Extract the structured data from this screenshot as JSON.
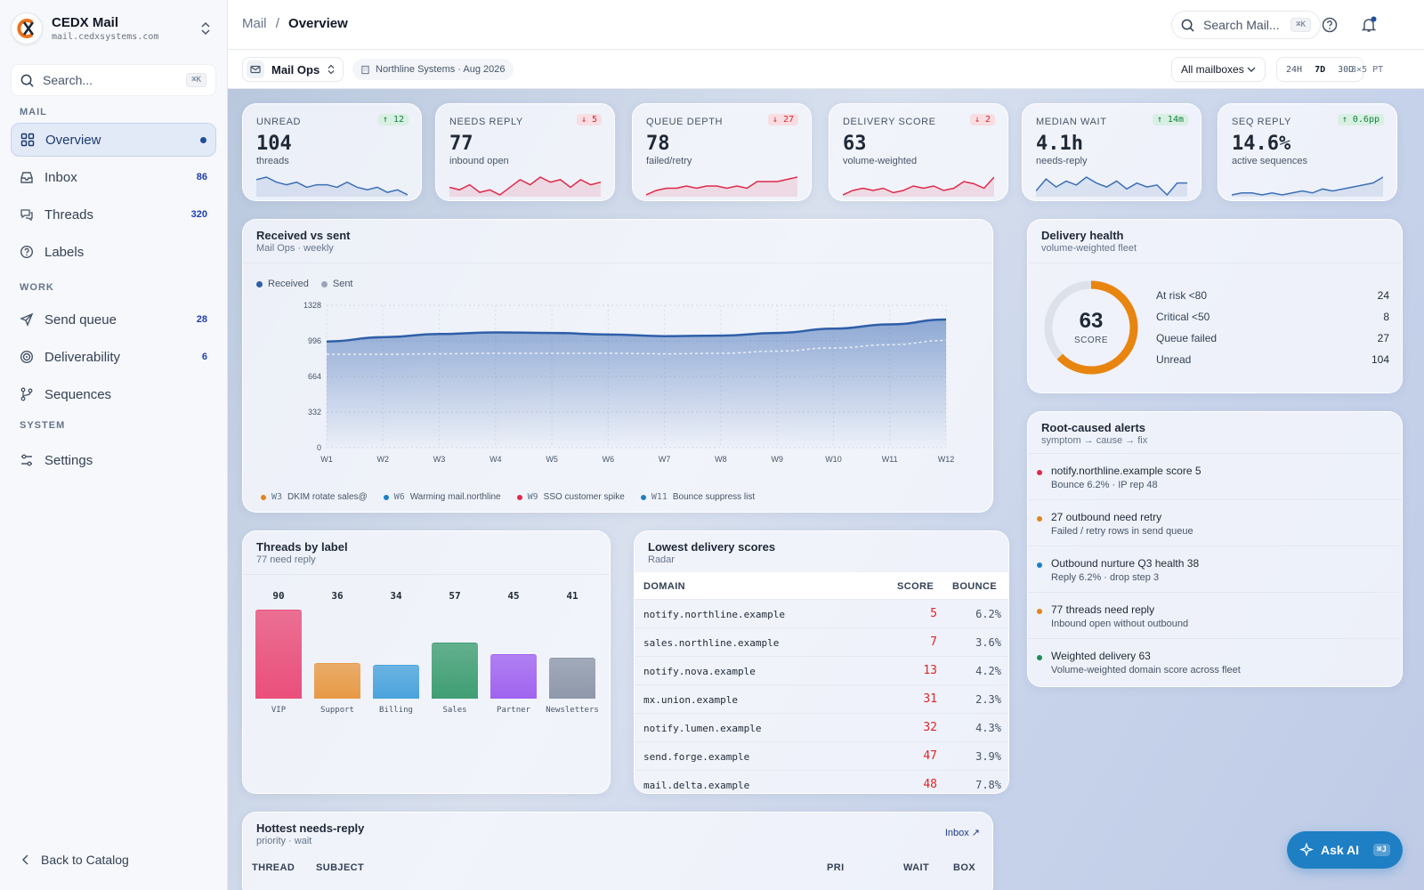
{
  "app": {
    "name": "CEDX Mail",
    "host": "mail.cedxsystems.com"
  },
  "sidebar": {
    "search_placeholder": "Search...",
    "search_kbd": "⌘K",
    "sections": {
      "mail": "MAIL",
      "work": "WORK",
      "system": "SYSTEM"
    },
    "items": [
      {
        "label": "Overview",
        "count": ""
      },
      {
        "label": "Inbox",
        "count": "86"
      },
      {
        "label": "Threads",
        "count": "320"
      },
      {
        "label": "Labels",
        "count": ""
      },
      {
        "label": "Send queue",
        "count": "28"
      },
      {
        "label": "Deliverability",
        "count": "6"
      },
      {
        "label": "Sequences",
        "count": ""
      },
      {
        "label": "Settings",
        "count": ""
      }
    ],
    "back": "Back to Catalog"
  },
  "header": {
    "crumb_root": "Mail",
    "crumb_sep": "/",
    "crumb_page": "Overview",
    "search_placeholder": "Search Mail...",
    "search_kbd": "⌘K"
  },
  "toolbar": {
    "workspace": "Mail Ops",
    "org": "Northline Systems · Aug 2026",
    "mailbox": "All mailboxes",
    "ranges": [
      "24H",
      "7D",
      "30D"
    ],
    "active_range": "7D",
    "tz": "8×5 PT"
  },
  "kpis": [
    {
      "label": "UNREAD",
      "value": "104",
      "sub": "threads",
      "delta": "↑ 12",
      "dir": "up",
      "spark": [
        14,
        15,
        13,
        12,
        13,
        11,
        12,
        12,
        11,
        13,
        11,
        10,
        11,
        9,
        10,
        8
      ],
      "color": "#3b6fb8"
    },
    {
      "label": "NEEDS REPLY",
      "value": "77",
      "sub": "inbound open",
      "delta": "↓ 5",
      "dir": "dn",
      "spark": [
        9,
        8,
        10,
        7,
        8,
        6,
        9,
        12,
        10,
        13,
        11,
        12,
        9,
        12,
        10,
        11
      ],
      "color": "#e0294a"
    },
    {
      "label": "QUEUE DEPTH",
      "value": "78",
      "sub": "failed/retry",
      "delta": "↓ 27",
      "dir": "dn",
      "spark": [
        5,
        7,
        8,
        8,
        9,
        8,
        9,
        9,
        8,
        9,
        8,
        11,
        11,
        11,
        12,
        13
      ],
      "color": "#e0294a"
    },
    {
      "label": "DELIVERY SCORE",
      "value": "63",
      "sub": "volume-weighted",
      "delta": "↓ 2",
      "dir": "dn",
      "spark": [
        6,
        8,
        9,
        8,
        9,
        7,
        8,
        10,
        9,
        10,
        8,
        9,
        12,
        11,
        9,
        14
      ],
      "color": "#e0294a"
    },
    {
      "label": "MEDIAN WAIT",
      "value": "4.1h",
      "sub": "needs-reply",
      "delta": "↑ 14m",
      "dir": "up",
      "spark": [
        8,
        14,
        10,
        13,
        11,
        15,
        12,
        10,
        13,
        9,
        12,
        10,
        11,
        6,
        12,
        12
      ],
      "color": "#3b6fb8"
    },
    {
      "label": "SEQ REPLY",
      "value": "14.6%",
      "sub": "active sequences",
      "delta": "↑ 0.6pp",
      "dir": "up",
      "spark": [
        6,
        7,
        7,
        6,
        7,
        6,
        7,
        8,
        7,
        9,
        8,
        9,
        10,
        11,
        12,
        15
      ],
      "color": "#3b6fb8"
    }
  ],
  "rvs": {
    "title": "Received vs sent",
    "sub": "Mail Ops · weekly",
    "legend": [
      "Received",
      "Sent"
    ],
    "colors": [
      "#2f5fa8",
      "#9aa6b8"
    ]
  },
  "chart_data": [
    {
      "type": "area",
      "title": "Received vs sent",
      "x": [
        "W1",
        "W2",
        "W3",
        "W4",
        "W5",
        "W6",
        "W7",
        "W8",
        "W9",
        "W10",
        "W11",
        "W12"
      ],
      "yticks": [
        "0",
        "332",
        "664",
        "996",
        "1328"
      ],
      "ylim": [
        0,
        1328
      ],
      "series": [
        {
          "name": "Received",
          "values": [
            990,
            1030,
            1060,
            1075,
            1070,
            1055,
            1040,
            1045,
            1070,
            1110,
            1150,
            1195
          ]
        },
        {
          "name": "Sent",
          "values": [
            870,
            870,
            875,
            880,
            880,
            880,
            875,
            880,
            900,
            930,
            960,
            1000
          ]
        }
      ],
      "annotations": [
        {
          "week": "W3",
          "text": "DKIM rotate sales@",
          "color": "#e0851b"
        },
        {
          "week": "W6",
          "text": "Warming mail.northline",
          "color": "#1f7fc4"
        },
        {
          "week": "W9",
          "text": "SSO customer spike",
          "color": "#e0294a"
        },
        {
          "week": "W11",
          "text": "Bounce suppress list",
          "color": "#1f7fc4"
        }
      ]
    },
    {
      "type": "bar",
      "title": "Threads by label",
      "categories": [
        "VIP",
        "Support",
        "Billing",
        "Sales",
        "Partner",
        "Newsletters"
      ],
      "values": [
        90,
        36,
        34,
        57,
        45,
        41
      ],
      "colors": [
        "#ea4f7a",
        "#e89a45",
        "#4aa3dc",
        "#3f9e73",
        "#a063f0",
        "#8e98aa"
      ]
    }
  ],
  "labels": {
    "title": "Threads by label",
    "sub": "77 need reply"
  },
  "lowest": {
    "title": "Lowest delivery scores",
    "sub": "Radar",
    "headers": [
      "DOMAIN",
      "SCORE",
      "BOUNCE"
    ],
    "rows": [
      {
        "domain": "notify.northline.example",
        "score": "5",
        "bounce": "6.2%"
      },
      {
        "domain": "sales.northline.example",
        "score": "7",
        "bounce": "3.6%"
      },
      {
        "domain": "notify.nova.example",
        "score": "13",
        "bounce": "4.2%"
      },
      {
        "domain": "mx.union.example",
        "score": "31",
        "bounce": "2.3%"
      },
      {
        "domain": "notify.lumen.example",
        "score": "32",
        "bounce": "4.3%"
      },
      {
        "domain": "send.forge.example",
        "score": "47",
        "bounce": "3.9%"
      },
      {
        "domain": "mail.delta.example",
        "score": "48",
        "bounce": "7.8%"
      }
    ]
  },
  "health": {
    "title": "Delivery health",
    "sub": "volume-weighted fleet",
    "score": "63",
    "score_label": "SCORE",
    "score_value": 63,
    "stats": [
      {
        "k": "At risk <80",
        "v": "24"
      },
      {
        "k": "Critical <50",
        "v": "8"
      },
      {
        "k": "Queue failed",
        "v": "27"
      },
      {
        "k": "Unread",
        "v": "104"
      }
    ]
  },
  "alerts": {
    "title": "Root-caused alerts",
    "sub": "symptom → cause → fix",
    "items": [
      {
        "title": "notify.northline.example score 5",
        "sub": "Bounce 6.2% · IP rep 48",
        "color": "#e0294a"
      },
      {
        "title": "27 outbound need retry",
        "sub": "Failed / retry rows in send queue",
        "color": "#e0851b"
      },
      {
        "title": "Outbound nurture Q3 health 38",
        "sub": "Reply 6.2% · drop step 3",
        "color": "#1f7fc4"
      },
      {
        "title": "77 threads need reply",
        "sub": "Inbound open without outbound",
        "color": "#e0851b"
      },
      {
        "title": "Weighted delivery 63",
        "sub": "Volume-weighted domain score across fleet",
        "color": "#1f8a5b"
      }
    ]
  },
  "hottest": {
    "title": "Hottest needs-reply",
    "sub": "priority · wait",
    "link": "Inbox ↗",
    "headers": [
      "THREAD",
      "SUBJECT",
      "PRI",
      "WAIT",
      "BOX"
    ]
  },
  "askai": {
    "label": "Ask AI",
    "kbd": "⌘J"
  }
}
